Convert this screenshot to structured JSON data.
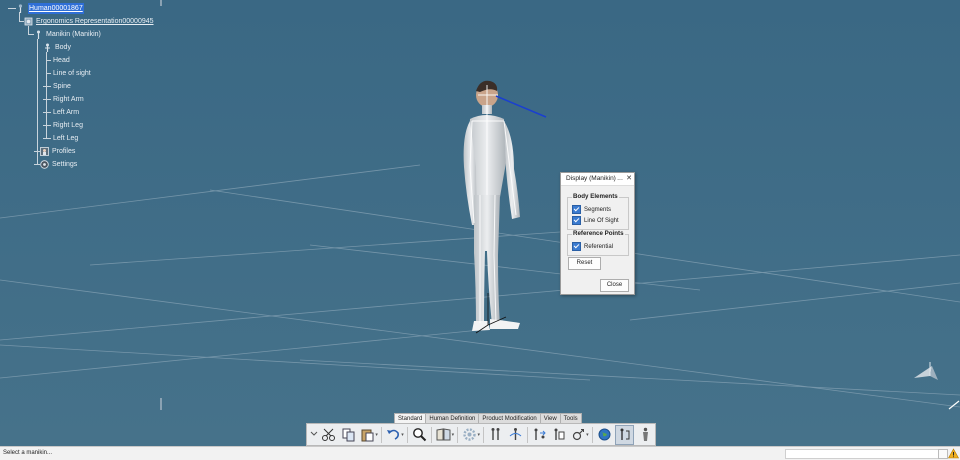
{
  "tree": {
    "root": "Human00001867",
    "ergonomics": "Ergonomics Representation00000945",
    "manikin": "Manikin (Manikin)",
    "body": "Body",
    "children": [
      "Head",
      "Line of sight",
      "Spine",
      "Right Arm",
      "Left Arm",
      "Right Leg",
      "Left Leg"
    ],
    "profiles": "Profiles",
    "settings": "Settings"
  },
  "dialog": {
    "title": "Display (Manikin)",
    "minimize_symbol": "...",
    "close_symbol": "✕",
    "body_elements": {
      "title": "Body Elements",
      "segments": "Segments",
      "line_of_sight": "Line Of Sight"
    },
    "reference_points": {
      "title": "Reference Points",
      "referential": "Referential"
    },
    "reset_label": "Reset",
    "close_label": "Close",
    "checked": {
      "segments": true,
      "line_of_sight": true,
      "referential": true
    }
  },
  "tabs": [
    "Standard",
    "Human Definition",
    "Product Modification",
    "View",
    "Tools"
  ],
  "active_tab": "Standard",
  "toolbar_icons": [
    "cut-icon",
    "copy-icon",
    "paste-icon",
    "undo-icon",
    "zoom-icon",
    "catalog-icon",
    "settings-gear-icon",
    "manikin-posture-icon",
    "manikin-reach-icon",
    "manikin-swap-icon",
    "manikin-copy-icon",
    "gender-icon",
    "globe-icon",
    "manikin-display-icon",
    "standing-manikin-icon"
  ],
  "status": {
    "message": "Select a manikin..."
  },
  "colors": {
    "viewport": "#3f6a86",
    "selection": "#2f6fd6",
    "checkbox": "#3b7bd0",
    "line_of_sight": "#1a3fd0"
  }
}
